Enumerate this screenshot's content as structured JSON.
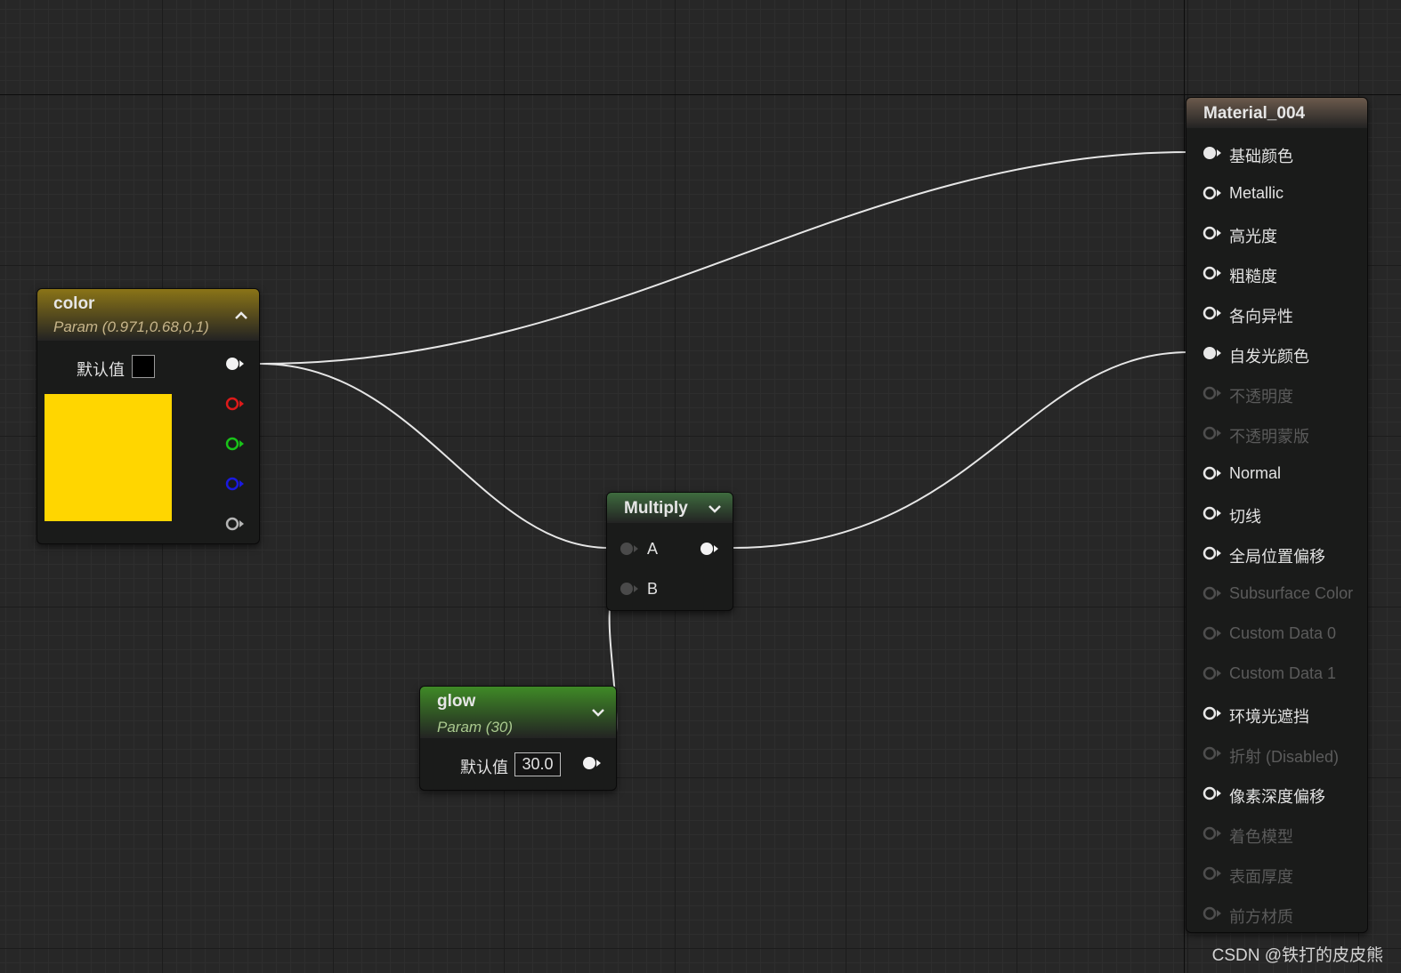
{
  "color_node": {
    "title": "color",
    "subtitle": "Param (0.971,0.68,0,1)",
    "default_label": "默认值",
    "default_swatch": "#000000",
    "preview_color": "#ffd600",
    "header_color": "#8a7417",
    "pins": [
      {
        "icon": "white-output-pin-icon",
        "color": "#f2f2f2"
      },
      {
        "icon": "red-output-pin-icon",
        "color": "#dd1a1a"
      },
      {
        "icon": "green-output-pin-icon",
        "color": "#19c219"
      },
      {
        "icon": "blue-output-pin-icon",
        "color": "#1a1ae0"
      },
      {
        "icon": "alpha-output-pin-icon",
        "color": "#b5b5b5"
      }
    ]
  },
  "multiply_node": {
    "title": "Multiply",
    "input_a": "A",
    "input_b": "B",
    "header_color": "#3e6b3e"
  },
  "glow_node": {
    "title": "glow",
    "subtitle": "Param (30)",
    "default_label": "默认值",
    "value": "30.0",
    "header_color": "#3f8a26"
  },
  "material_node": {
    "title": "Material_004",
    "header_color": "#6b5a4c",
    "inputs": [
      {
        "label": "基础颜色",
        "enabled": true,
        "connected": true
      },
      {
        "label": "Metallic",
        "enabled": true,
        "connected": false
      },
      {
        "label": "高光度",
        "enabled": true,
        "connected": false
      },
      {
        "label": "粗糙度",
        "enabled": true,
        "connected": false
      },
      {
        "label": "各向异性",
        "enabled": true,
        "connected": false
      },
      {
        "label": "自发光颜色",
        "enabled": true,
        "connected": true
      },
      {
        "label": "不透明度",
        "enabled": false,
        "connected": false
      },
      {
        "label": "不透明蒙版",
        "enabled": false,
        "connected": false
      },
      {
        "label": "Normal",
        "enabled": true,
        "connected": false
      },
      {
        "label": "切线",
        "enabled": true,
        "connected": false
      },
      {
        "label": "全局位置偏移",
        "enabled": true,
        "connected": false
      },
      {
        "label": "Subsurface Color",
        "enabled": false,
        "connected": false
      },
      {
        "label": "Custom Data 0",
        "enabled": false,
        "connected": false
      },
      {
        "label": "Custom Data 1",
        "enabled": false,
        "connected": false
      },
      {
        "label": "环境光遮挡",
        "enabled": true,
        "connected": false
      },
      {
        "label": "折射 (Disabled)",
        "enabled": false,
        "connected": false
      },
      {
        "label": "像素深度偏移",
        "enabled": true,
        "connected": false
      },
      {
        "label": "着色模型",
        "enabled": false,
        "connected": false
      },
      {
        "label": "表面厚度",
        "enabled": false,
        "connected": false
      },
      {
        "label": "前方材质",
        "enabled": false,
        "connected": false
      }
    ]
  },
  "watermark": "CSDN @铁打的皮皮熊"
}
